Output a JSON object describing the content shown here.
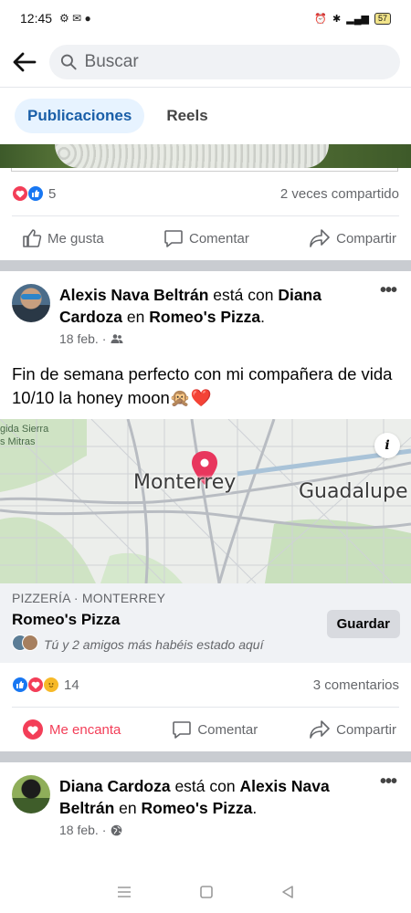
{
  "status": {
    "time": "12:45",
    "battery": "57"
  },
  "search": {
    "placeholder": "Buscar"
  },
  "tabs": [
    {
      "label": "Publicaciones",
      "active": true
    },
    {
      "label": "Reels",
      "active": false
    }
  ],
  "prev_post": {
    "reaction_count": "5",
    "shares": "2 veces compartido",
    "actions": {
      "like": "Me gusta",
      "comment": "Comentar",
      "share": "Compartir"
    }
  },
  "post1": {
    "author": "Alexis Nava Beltrán",
    "with_text": "está con",
    "tagged": "Diana Cardoza",
    "at_text": "en",
    "place": "Romeo's Pizza",
    "period": ".",
    "date": "18 feb. ·",
    "text_line1": "Fin de semana perfecto con mi compañera de vida",
    "text_line2": "10/10 la honey moon🙊❤️",
    "map": {
      "label_city": "Monterrey",
      "label_city2": "Guadalupe",
      "label_park_line1": "gida Sierra",
      "label_park_line2": "s Mitras",
      "info": "i"
    },
    "place_card": {
      "category": "PIZZERÍA · MONTERREY",
      "name": "Romeo's Pizza",
      "friends": "Tú y 2 amigos más habéis estado aquí",
      "save": "Guardar"
    },
    "reaction_count": "14",
    "comments": "3 comentarios",
    "actions": {
      "love": "Me encanta",
      "comment": "Comentar",
      "share": "Compartir"
    }
  },
  "post2": {
    "author": "Diana Cardoza",
    "with_text": "está con",
    "tagged": "Alexis Nava Beltrán",
    "at_text": "en",
    "place": "Romeo's Pizza",
    "period": ".",
    "date": "18 feb. ·"
  },
  "colors": {
    "accent": "#1877f2",
    "love": "#f33e58",
    "active_tab_bg": "#e7f3ff",
    "pin": "#e8365d"
  }
}
